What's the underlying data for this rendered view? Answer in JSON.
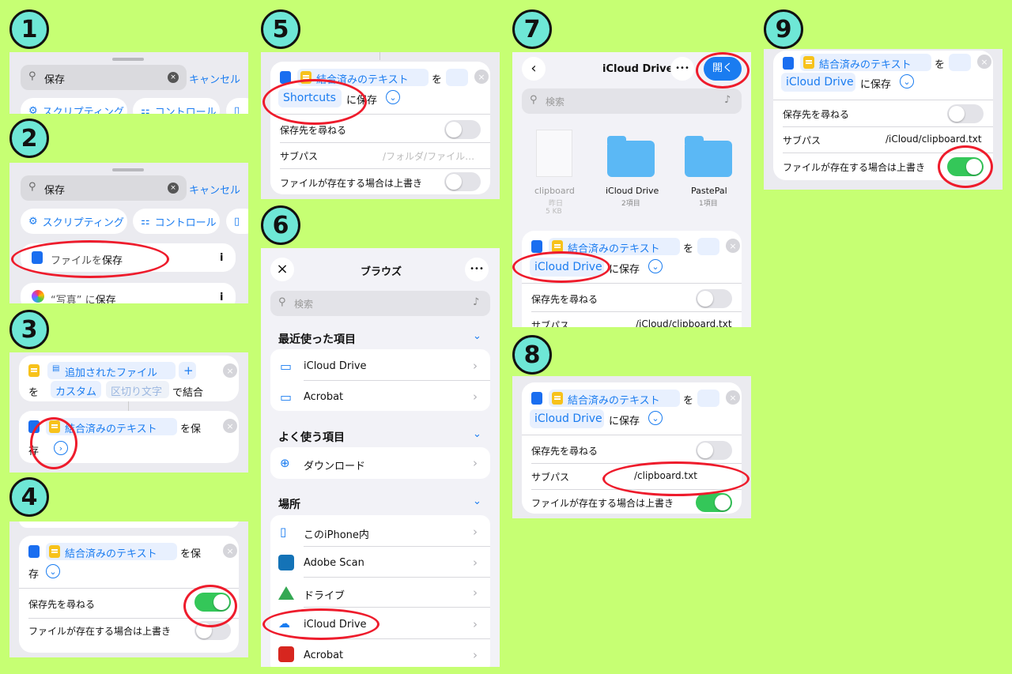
{
  "badges": [
    "1",
    "2",
    "3",
    "4",
    "5",
    "6",
    "7",
    "8",
    "9"
  ],
  "common": {
    "save_query": "保存",
    "cancel": "キャンセル",
    "scripting": "スクリプティング",
    "control": "コントロール",
    "combined_text": "結合済みのテキスト",
    "wo": "を",
    "ni_save": "に保存",
    "ask_where": "保存先を尋ねる",
    "subpath": "サブパス",
    "overwrite": "ファイルが存在する場合は上書き",
    "save_wo": "を保",
    "save_wo2": "存",
    "search": "検索",
    "icloud": "iCloud Drive",
    "close": "×",
    "ellipsis": "•••"
  },
  "p2": {
    "item1_a": "ファイルを",
    "item1_b": "保存",
    "item2_a": "“写真” に",
    "item2_b": "保存",
    "info": "i"
  },
  "p3": {
    "added_files": "追加されたファイル",
    "plus": "+",
    "wo": "を",
    "custom": "カスタム",
    "separator": "区切り文字",
    "de_combine": "で結合"
  },
  "p5": {
    "dest": "Shortcuts",
    "ni_save": "に保存",
    "subpath_placeholder": "/フォルダ/ファイル…"
  },
  "p6": {
    "title": "ブラウズ",
    "recent": "最近使った項目",
    "favorites": "よく使う項目",
    "places": "場所",
    "recent_items": [
      "iCloud Drive",
      "Acrobat"
    ],
    "fav_items": [
      "ダウンロード"
    ],
    "place_items": [
      "このiPhone内",
      "Adobe Scan",
      "ドライブ",
      "iCloud Drive",
      "Acrobat"
    ]
  },
  "p7": {
    "title": "iCloud Drive",
    "open": "開く",
    "files": [
      {
        "name": "clipboard",
        "sub1": "昨日",
        "sub2": "5 KB"
      },
      {
        "name": "iCloud Drive",
        "sub1": "2項目",
        "sub2": ""
      },
      {
        "name": "PastePal",
        "sub1": "1項目",
        "sub2": ""
      }
    ],
    "subpath_value": "/iCloud/clipboard.txt"
  },
  "p8": {
    "subpath_value": "/clipboard.txt"
  },
  "p9": {
    "subpath_value": "/iCloud/clipboard.txt"
  },
  "colors": {
    "background": "#c6ff73",
    "accent": "#1a7cf0",
    "toggle_on": "#34c759",
    "highlight": "#ee1c2c"
  }
}
